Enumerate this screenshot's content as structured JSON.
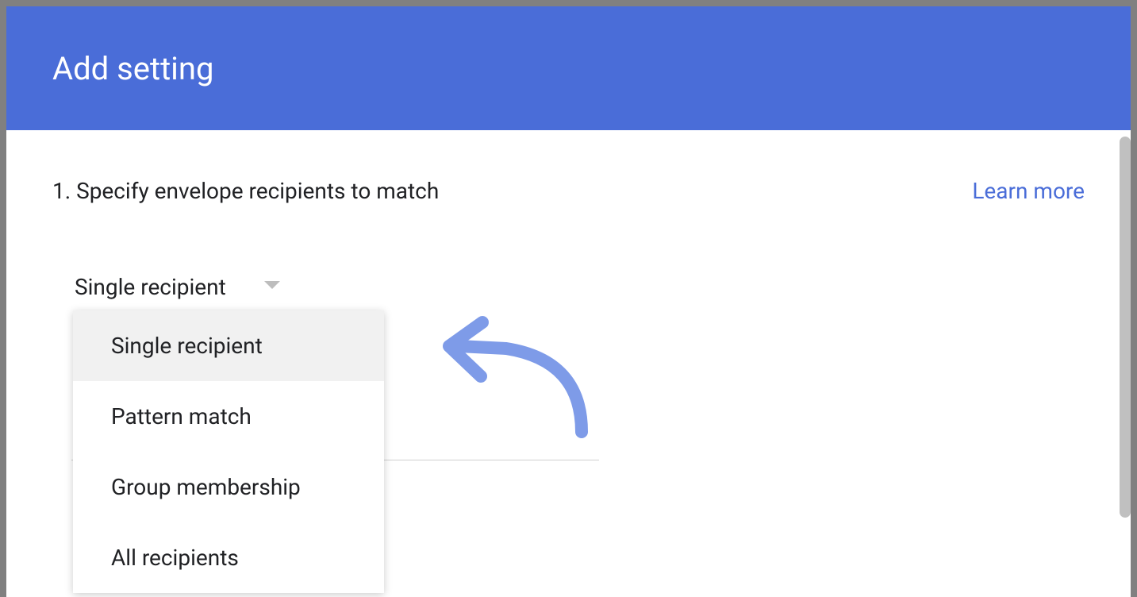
{
  "header": {
    "title": "Add setting"
  },
  "section": {
    "label": "1. Specify envelope recipients to match",
    "learn_more": "Learn more"
  },
  "dropdown": {
    "selected": "Single recipient",
    "options": [
      "Single recipient",
      "Pattern match",
      "Group membership",
      "All recipients"
    ]
  }
}
